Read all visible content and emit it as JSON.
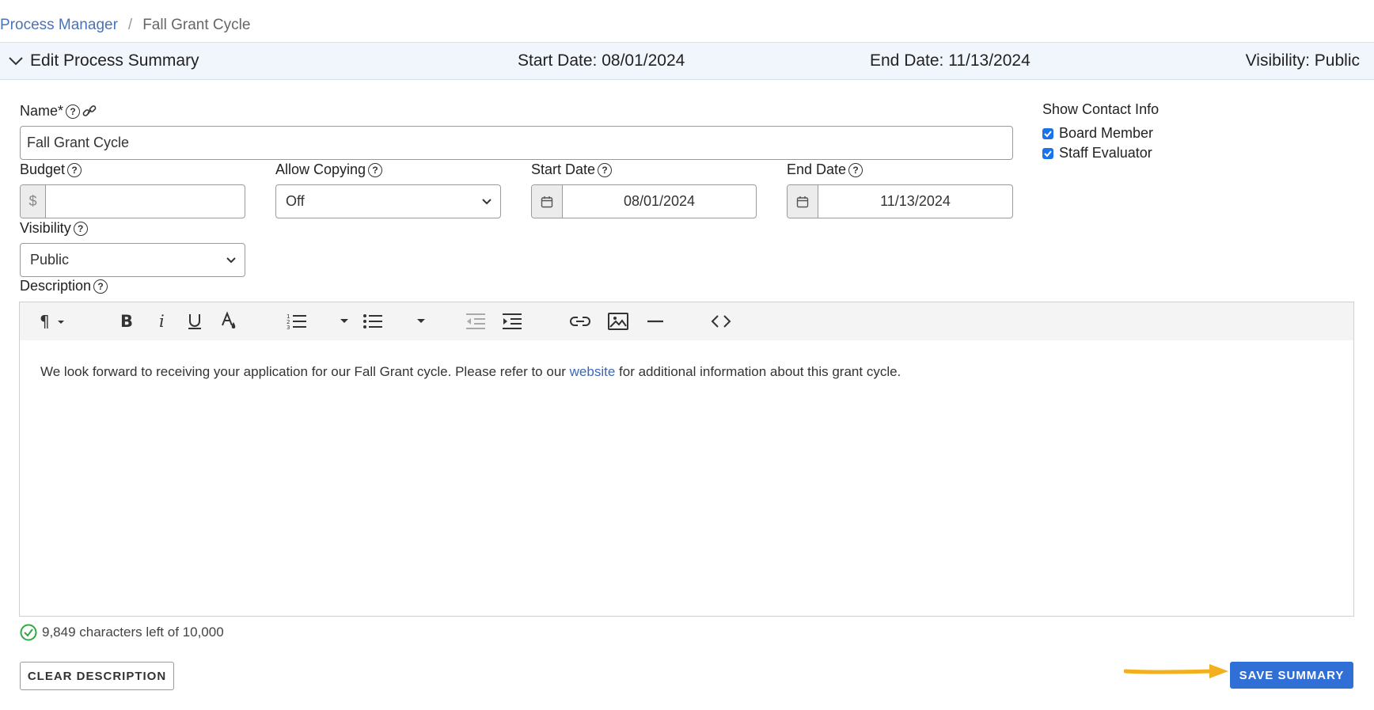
{
  "breadcrumb": {
    "parent": "Process Manager",
    "separator": "/",
    "current": "Fall Grant Cycle"
  },
  "summary": {
    "title": "Edit Process Summary",
    "start": "Start Date: 08/01/2024",
    "end": "End Date: 11/13/2024",
    "visibility": "Visibility: Public"
  },
  "form": {
    "name_label": "Name*",
    "name_value": "Fall Grant Cycle",
    "budget_label": "Budget",
    "budget_symbol": "$",
    "budget_value": "",
    "allow_copying_label": "Allow Copying",
    "allow_copying_value": "Off",
    "start_date_label": "Start Date",
    "start_date_value": "08/01/2024",
    "end_date_label": "End Date",
    "end_date_value": "11/13/2024",
    "visibility_label": "Visibility",
    "visibility_value": "Public",
    "description_label": "Description"
  },
  "contact": {
    "heading": "Show Contact Info",
    "options": [
      {
        "label": "Board Member",
        "checked": true
      },
      {
        "label": "Staff Evaluator",
        "checked": true
      }
    ]
  },
  "editor": {
    "text_before": "We look forward to receiving your application for our Fall Grant cycle. Please refer to our ",
    "link_text": "website",
    "text_after": " for additional information about this grant cycle."
  },
  "char_count": "9,849 characters left of 10,000",
  "buttons": {
    "clear": "CLEAR DESCRIPTION",
    "save": "SAVE SUMMARY"
  },
  "colors": {
    "link": "#4a72b8",
    "primary": "#2f6fd6",
    "success": "#2eaa3f",
    "arrow": "#f2b01e",
    "bar_bg": "#f1f6fc"
  }
}
